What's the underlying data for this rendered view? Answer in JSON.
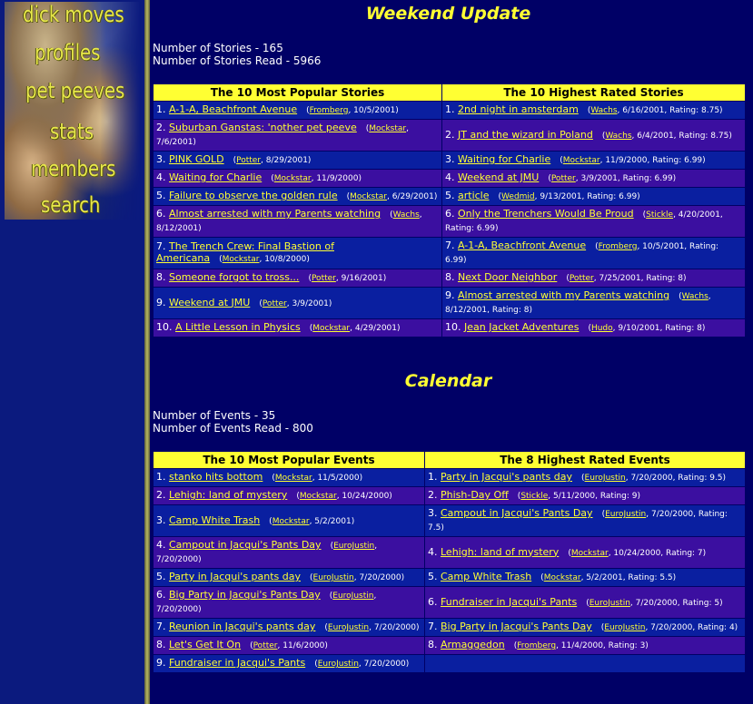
{
  "nav": [
    {
      "label": "dick moves"
    },
    {
      "label": "profiles"
    },
    {
      "label": "pet peeves"
    },
    {
      "label": "stats"
    },
    {
      "label": "members"
    },
    {
      "label": "search"
    }
  ],
  "weekend": {
    "title": "Weekend Update",
    "stories_count": "Number of Stories - 165",
    "stories_read": "Number of Stories Read - 5966",
    "popular_header": "The 10 Most Popular Stories",
    "rated_header": "The 10 Highest Rated Stories",
    "rows": [
      {
        "p": {
          "n": "1.",
          "t": "A-1-A, Beachfront Avenue",
          "u": "Fromberg",
          "m": ", 10/5/2001)"
        },
        "r": {
          "n": "1.",
          "t": "2nd night in amsterdam",
          "u": "Wachs",
          "m": ", 6/16/2001, Rating: 8.75)"
        }
      },
      {
        "p": {
          "n": "2.",
          "t": "Suburban Ganstas: 'nother pet peeve",
          "u": "Mockstar",
          "m": ", 7/6/2001)"
        },
        "r": {
          "n": "2.",
          "t": "JT and the wizard in Poland",
          "u": "Wachs",
          "m": ", 6/4/2001, Rating: 8.75)"
        }
      },
      {
        "p": {
          "n": "3.",
          "t": "PINK GOLD",
          "u": "Potter",
          "m": ", 8/29/2001)"
        },
        "r": {
          "n": "3.",
          "t": "Waiting for Charlie",
          "u": "Mockstar",
          "m": ", 11/9/2000, Rating: 6.99)"
        }
      },
      {
        "p": {
          "n": "4.",
          "t": "Waiting for Charlie",
          "u": "Mockstar",
          "m": ", 11/9/2000)"
        },
        "r": {
          "n": "4.",
          "t": "Weekend at JMU",
          "u": "Potter",
          "m": ", 3/9/2001, Rating: 6.99)"
        }
      },
      {
        "p": {
          "n": "5.",
          "t": "Failure to observe the golden rule",
          "u": "Mockstar",
          "m": ", 6/29/2001)"
        },
        "r": {
          "n": "5.",
          "t": "article",
          "u": "Wedmid",
          "m": ", 9/13/2001, Rating: 6.99)"
        }
      },
      {
        "p": {
          "n": "6.",
          "t": "Almost arrested with my Parents watching",
          "u": "Wachs",
          "m": ", 8/12/2001)"
        },
        "r": {
          "n": "6.",
          "t": "Only the Trenchers Would Be Proud",
          "u": "Stickle",
          "m": ", 4/20/2001, Rating: 6.99)"
        }
      },
      {
        "p": {
          "n": "7.",
          "t": "The Trench Crew: Final Bastion of Americana",
          "u": "Mockstar",
          "m": ", 10/8/2000)"
        },
        "r": {
          "n": "7.",
          "t": "A-1-A, Beachfront Avenue",
          "u": "Fromberg",
          "m": ", 10/5/2001, Rating: 6.99)"
        }
      },
      {
        "p": {
          "n": "8.",
          "t": "Someone forgot to tross...",
          "u": "Potter",
          "m": ", 9/16/2001)"
        },
        "r": {
          "n": "8.",
          "t": "Next Door Neighbor",
          "u": "Potter",
          "m": ", 7/25/2001, Rating: 8)"
        }
      },
      {
        "p": {
          "n": "9.",
          "t": "Weekend at JMU",
          "u": "Potter",
          "m": ", 3/9/2001)"
        },
        "r": {
          "n": "9.",
          "t": "Almost arrested with my Parents watching",
          "u": "Wachs",
          "m": ", 8/12/2001, Rating: 8)"
        }
      },
      {
        "p": {
          "n": "10.",
          "t": "A Little Lesson in Physics",
          "u": "Mockstar",
          "m": ", 4/29/2001)"
        },
        "r": {
          "n": "10.",
          "t": "Jean Jacket Adventures",
          "u": "Hudo",
          "m": ", 9/10/2001, Rating: 8)"
        }
      }
    ]
  },
  "calendar": {
    "title": "Calendar",
    "events_count": "Number of Events - 35",
    "events_read": "Number of Events Read - 800",
    "popular_header": "The 10 Most Popular Events",
    "rated_header": "The 8 Highest Rated Events",
    "rows": [
      {
        "p": {
          "n": "1.",
          "t": "stanko hits bottom",
          "u": "Mockstar",
          "m": ", 11/5/2000)"
        },
        "r": {
          "n": "1.",
          "t": "Party in Jacqui's pants day",
          "u": "EuroJustin",
          "m": ", 7/20/2000, Rating: 9.5)"
        }
      },
      {
        "p": {
          "n": "2.",
          "t": "Lehigh: land of mystery",
          "u": "Mockstar",
          "m": ", 10/24/2000)"
        },
        "r": {
          "n": "2.",
          "t": "Phish-Day Off",
          "u": "Stickle",
          "m": ", 5/11/2000, Rating: 9)"
        }
      },
      {
        "p": {
          "n": "3.",
          "t": "Camp White Trash",
          "u": "Mockstar",
          "m": ", 5/2/2001)"
        },
        "r": {
          "n": "3.",
          "t": "Campout in Jacqui's Pants Day",
          "u": "EuroJustin",
          "m": ", 7/20/2000, Rating: 7.5)"
        }
      },
      {
        "p": {
          "n": "4.",
          "t": "Campout in Jacqui's Pants Day",
          "u": "EuroJustin",
          "m": ", 7/20/2000)"
        },
        "r": {
          "n": "4.",
          "t": "Lehigh: land of mystery",
          "u": "Mockstar",
          "m": ", 10/24/2000, Rating: 7)"
        }
      },
      {
        "p": {
          "n": "5.",
          "t": "Party in Jacqui's pants day",
          "u": "EuroJustin",
          "m": ", 7/20/2000)"
        },
        "r": {
          "n": "5.",
          "t": "Camp White Trash",
          "u": "Mockstar",
          "m": ", 5/2/2001, Rating: 5.5)"
        }
      },
      {
        "p": {
          "n": "6.",
          "t": "Big Party in Jacqui's Pants Day",
          "u": "EuroJustin",
          "m": ", 7/20/2000)"
        },
        "r": {
          "n": "6.",
          "t": "Fundraiser in Jacqui's Pants",
          "u": "EuroJustin",
          "m": ", 7/20/2000, Rating: 5)"
        }
      },
      {
        "p": {
          "n": "7.",
          "t": "Reunion in Jacqui's pants day",
          "u": "EuroJustin",
          "m": ", 7/20/2000)"
        },
        "r": {
          "n": "7.",
          "t": "Big Party in Jacqui's Pants Day",
          "u": "EuroJustin",
          "m": ", 7/20/2000, Rating: 4)"
        }
      },
      {
        "p": {
          "n": "8.",
          "t": "Let's Get It On",
          "u": "Potter",
          "m": ", 11/6/2000)"
        },
        "r": {
          "n": "8.",
          "t": "Armaggedon",
          "u": "Fromberg",
          "m": ", 11/4/2000, Rating: 3)"
        }
      },
      {
        "p": {
          "n": "9.",
          "t": "Fundraiser in Jacqui's Pants",
          "u": "EuroJustin",
          "m": ", 7/20/2000)"
        },
        "r": null
      }
    ]
  }
}
